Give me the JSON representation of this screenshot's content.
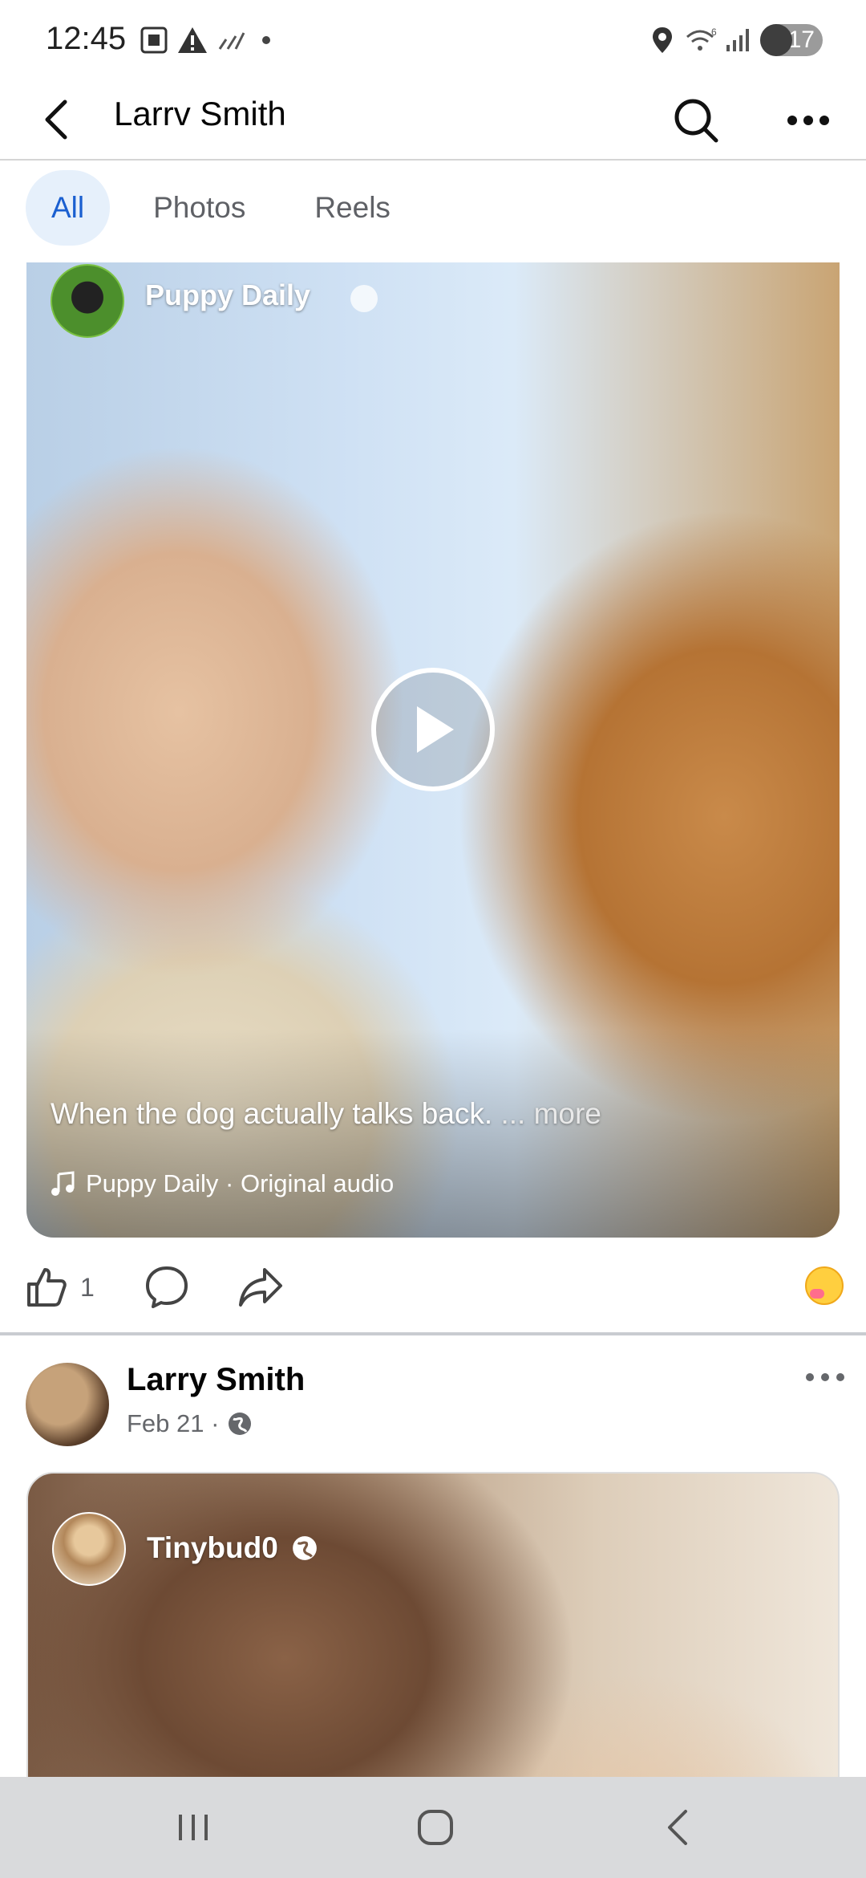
{
  "status_bar": {
    "time": "12:45",
    "battery": "17",
    "network": "6"
  },
  "header": {
    "title": "Larrv Smith",
    "icons": [
      "back-arrow-icon",
      "search-icon",
      "more-dots-icon"
    ]
  },
  "tabs": [
    {
      "label": "All",
      "active": true
    },
    {
      "label": "Photos",
      "active": false
    },
    {
      "label": "Reels",
      "active": false
    }
  ],
  "video_post": {
    "page_name": "Puppy Daily",
    "caption": "When the dog actually talks back.",
    "more_label": "... more",
    "audio": "Puppy Daily · Original audio"
  },
  "actions": {
    "like_count": "1",
    "icons": [
      "like-icon",
      "comment-icon",
      "share-icon",
      "reaction-emoji-icon"
    ]
  },
  "second_post": {
    "author": "Larry Smith",
    "date": "Feb 21 ·",
    "shared_page": "Tinybud0"
  },
  "colors": {
    "active_tab_bg": "#e6f0fb",
    "active_tab_text": "#1a5fd0",
    "secondary_text": "#65676b",
    "nav_bar": "#d9dadc"
  }
}
